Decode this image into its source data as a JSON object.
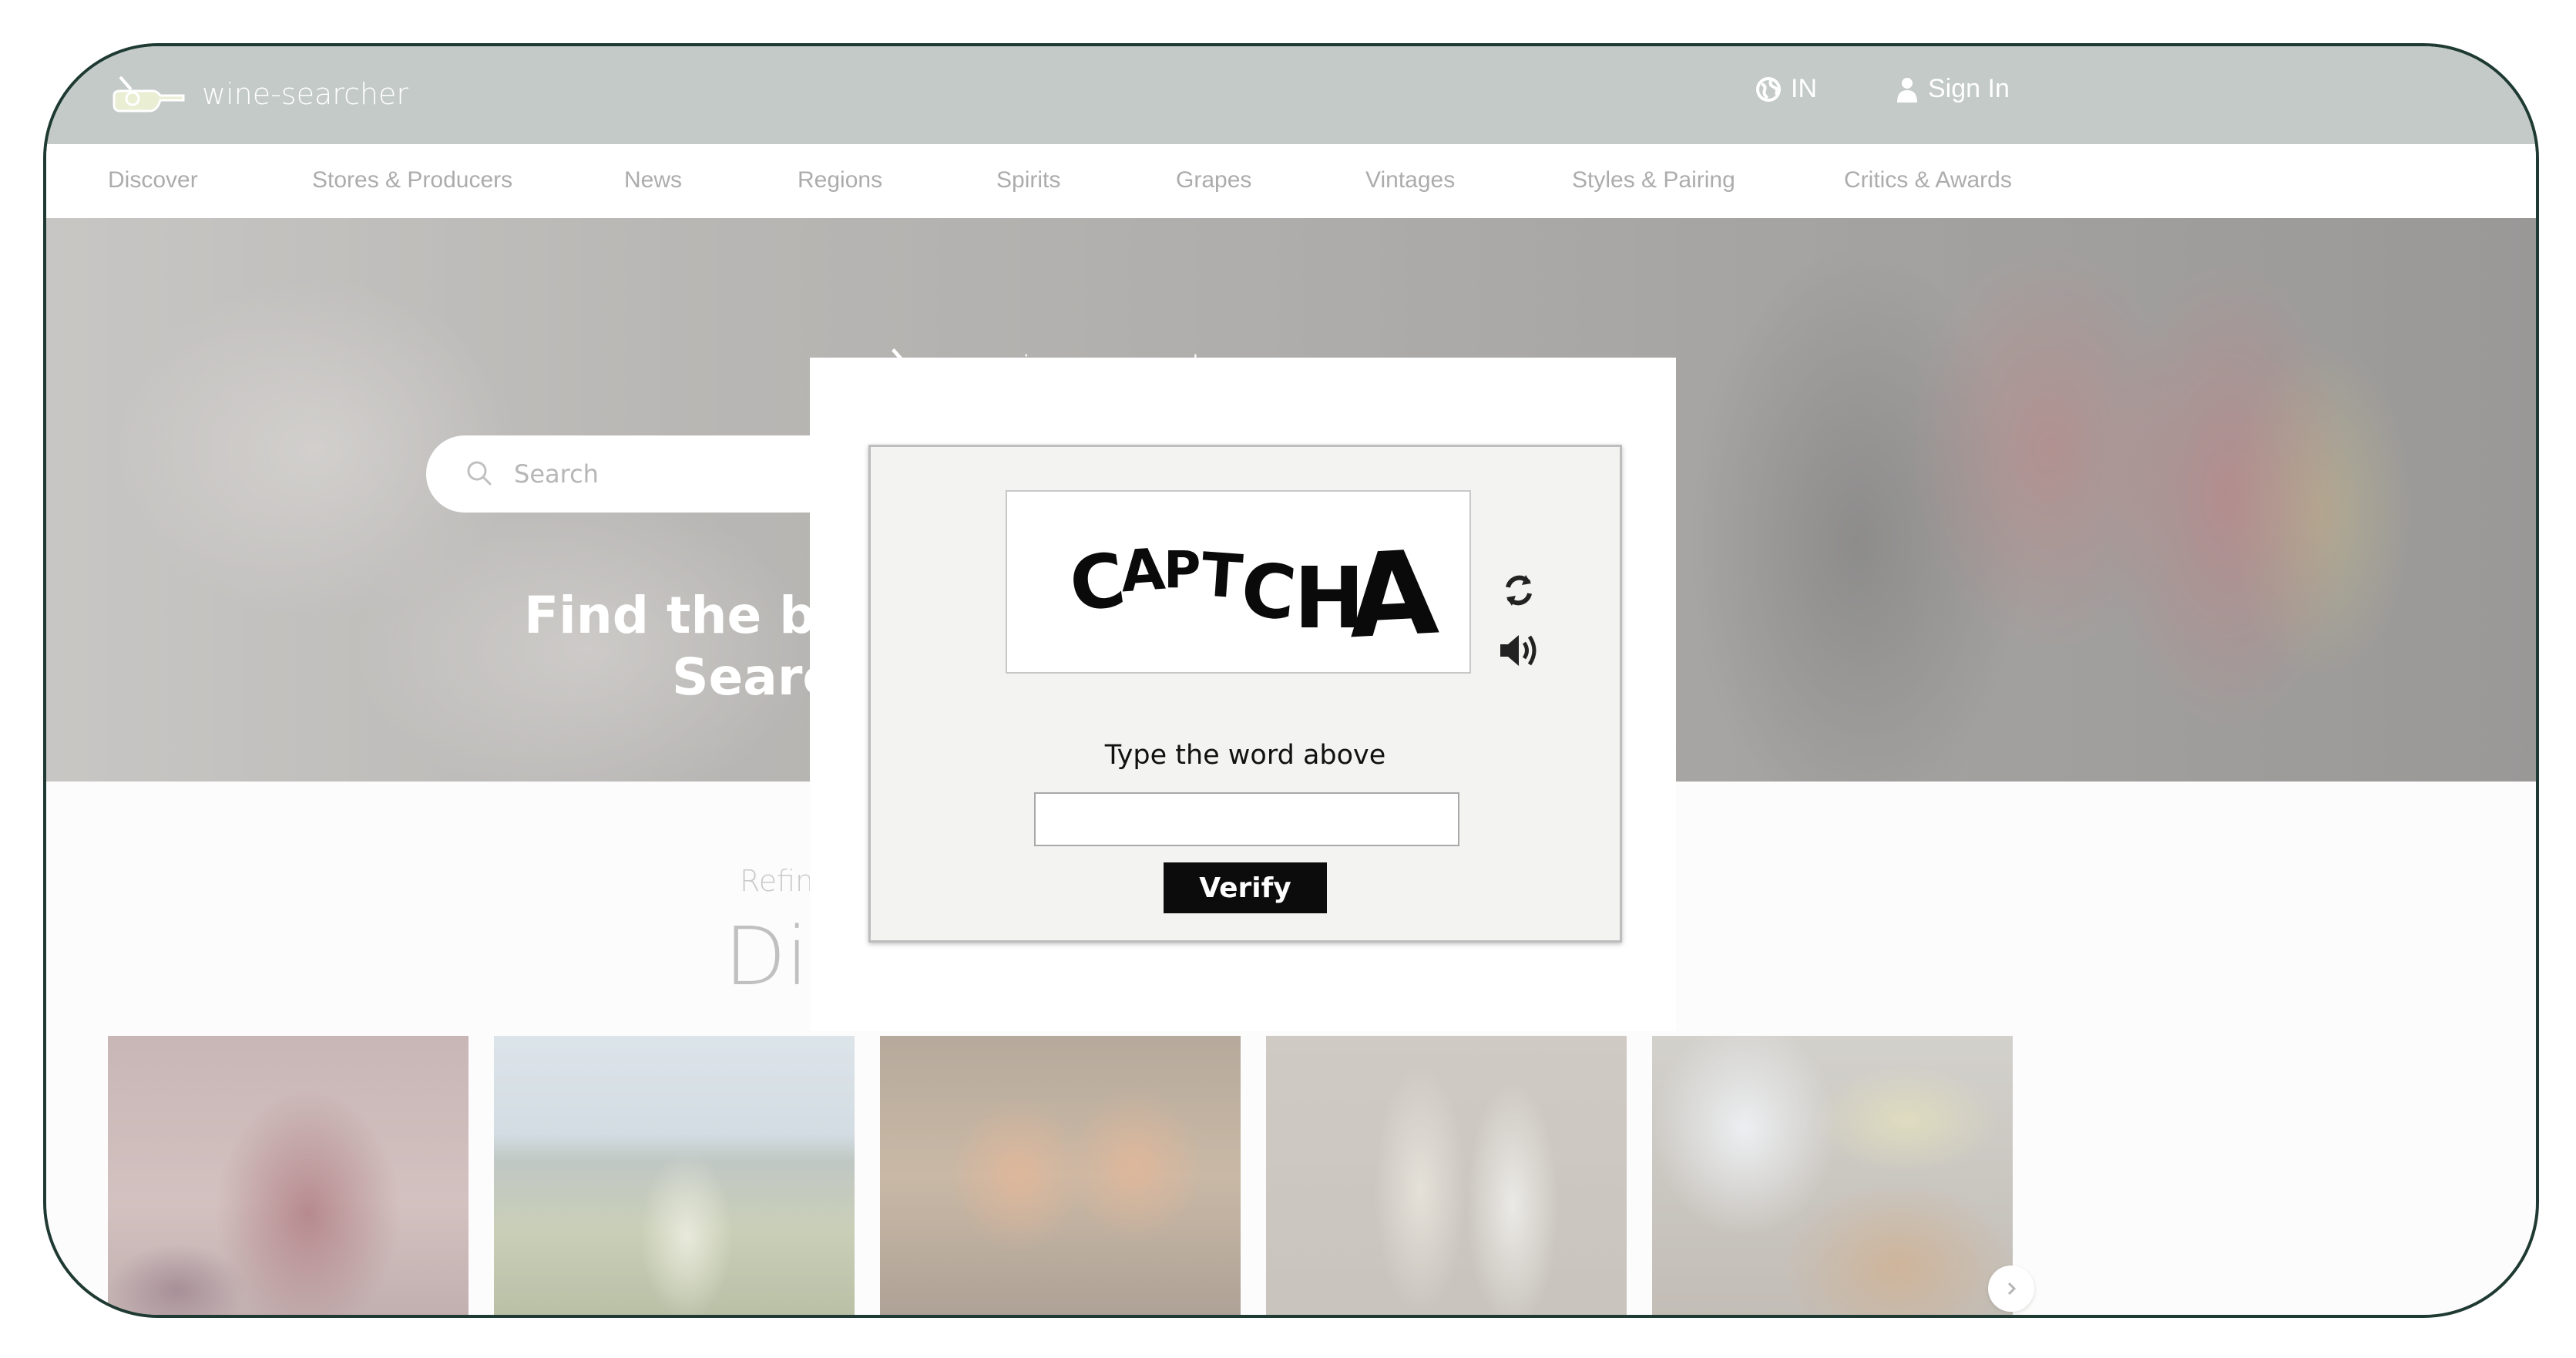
{
  "brand": {
    "name": "wine-searcher"
  },
  "header": {
    "country": "IN",
    "signin_label": "Sign In"
  },
  "nav": {
    "items": [
      "Discover",
      "Stores & Producers",
      "News",
      "Regions",
      "Spirits",
      "Grapes",
      "Vintages",
      "Styles & Pairing",
      "Critics & Awards"
    ]
  },
  "hero": {
    "search_placeholder": "Search",
    "line1": "Find the best p",
    "line2": "Search t"
  },
  "section": {
    "refine": "Refine yo",
    "title": "Disc"
  },
  "captcha": {
    "word": "CAPTCHA",
    "instruction": "Type the word above",
    "input_value": "",
    "verify_label": "Verify"
  },
  "colors": {
    "header_bg": "#9eaaa5",
    "verify_bg": "#0c0c0c",
    "frame_border": "#1f3a33"
  },
  "icons": [
    "logo-bottle-icon",
    "globe-icon",
    "user-icon",
    "search-icon",
    "refresh-icon",
    "audio-icon",
    "chevron-right-icon"
  ]
}
